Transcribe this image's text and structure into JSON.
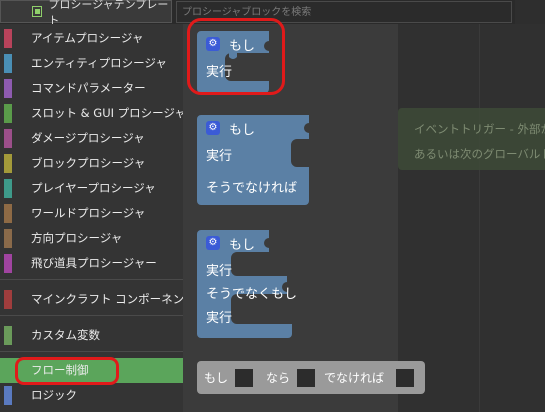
{
  "top_bar": {
    "templates_tab": "プロシージャテンプレート",
    "search_placeholder": "プロシージャブロックを検索"
  },
  "sidebar": {
    "items": [
      {
        "label": "アイテムプロシージャ",
        "color": "#b8435b"
      },
      {
        "label": "エンティティプロシージャ",
        "color": "#4a8fb5"
      },
      {
        "label": "コマンドパラメーター",
        "color": "#8e5bb0"
      },
      {
        "label": "スロット & GUI プロシージャ",
        "color": "#5a9b4a"
      },
      {
        "label": "ダメージプロシージャ",
        "color": "#9c4f8a"
      },
      {
        "label": "ブロックプロシージャ",
        "color": "#a39a3a"
      },
      {
        "label": "プレイヤープロシージャ",
        "color": "#3e9a8a"
      },
      {
        "label": "ワールドプロシージャ",
        "color": "#8e6a45"
      },
      {
        "label": "方向プロシージャ",
        "color": "#8a6a4a"
      },
      {
        "label": "飛び道具プロシージャー",
        "color": "#a044a0"
      },
      {
        "label": "マインクラフト コンポーネント",
        "color": "#a03d3d"
      },
      {
        "label": "カスタム変数",
        "color": "#6a9a5a"
      },
      {
        "label": "フロー制御",
        "color": "#5ba55b",
        "selected": true
      },
      {
        "label": "ロジック",
        "color": "#5a7ac0"
      }
    ]
  },
  "blocks": {
    "if_label": "もし",
    "do_label": "実行",
    "else_label": "そうでなければ",
    "elseif_label": "そうでなくもし",
    "ternary": {
      "if": "もし",
      "then": "なら",
      "else": "でなければ"
    },
    "gear_icon": "gear-icon"
  },
  "event_block": {
    "line1": "イベントトリガー - 外部か",
    "line2": "あるいは次のグローバルト"
  },
  "colors": {
    "block_blue": "#5b80a5",
    "ternary_gray": "#9a9a9a",
    "selected_green": "#5ba55b",
    "highlight_red": "#e01a1a"
  }
}
